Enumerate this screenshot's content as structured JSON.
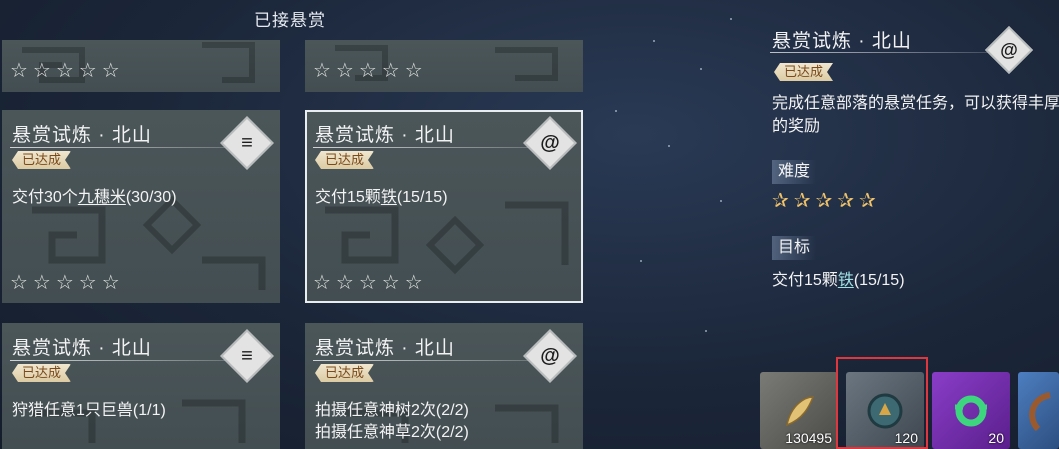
{
  "header": {
    "title": "已接悬赏"
  },
  "cards": [
    {
      "title": "",
      "badge": "",
      "task_prefix": "",
      "task_item": "",
      "task_suffix": "",
      "stars": "☆☆☆☆☆"
    },
    {
      "title": "",
      "badge": "",
      "task_prefix": "",
      "task_item": "",
      "task_suffix": "",
      "stars": "☆☆☆☆☆"
    },
    {
      "title": "悬赏试炼 · 北山",
      "badge": "已达成",
      "emblem": "stripes-icon",
      "task_prefix": "交付30个",
      "task_item": "九穗米",
      "task_suffix": "(30/30)",
      "stars": "☆☆☆☆☆"
    },
    {
      "title": "悬赏试炼 · 北山",
      "badge": "已达成",
      "emblem": "swirl-icon",
      "task_prefix": "交付15颗",
      "task_item": "铁",
      "task_suffix": "(15/15)",
      "stars": "☆☆☆☆☆"
    },
    {
      "title": "悬赏试炼 · 北山",
      "badge": "已达成",
      "emblem": "stripes-icon",
      "task_line1": "狩猎任意1只巨兽(1/1)"
    },
    {
      "title": "悬赏试炼 · 北山",
      "badge": "已达成",
      "emblem": "swirl-icon",
      "task_line1": "拍摄任意神树2次(2/2)",
      "task_line2": "拍摄任意神草2次(2/2)"
    }
  ],
  "detail": {
    "title": "悬赏试炼 · 北山",
    "badge": "已达成",
    "description": "完成任意部落的悬赏任务，可以获得丰厚的奖励",
    "difficulty_label": "难度",
    "difficulty_stars": "✰✰✰✰✰",
    "target_label": "目标",
    "target_prefix": "交付15颗",
    "target_item": "铁",
    "target_suffix": "(15/15)"
  },
  "rewards": [
    {
      "icon": "gold-feather-icon",
      "count": "130495",
      "color": "#6b6b68"
    },
    {
      "icon": "bronze-coin-icon",
      "count": "120",
      "color": "#56606a"
    },
    {
      "icon": "jade-ring-icon",
      "count": "20",
      "color": "#7a2fb5"
    },
    {
      "icon": "horn-icon",
      "count": "",
      "color": "#3f6aa6"
    }
  ],
  "colors": {
    "highlight": "#e0373f",
    "badge_text": "#7a4a1d",
    "star_gold": "#f0c36a"
  }
}
